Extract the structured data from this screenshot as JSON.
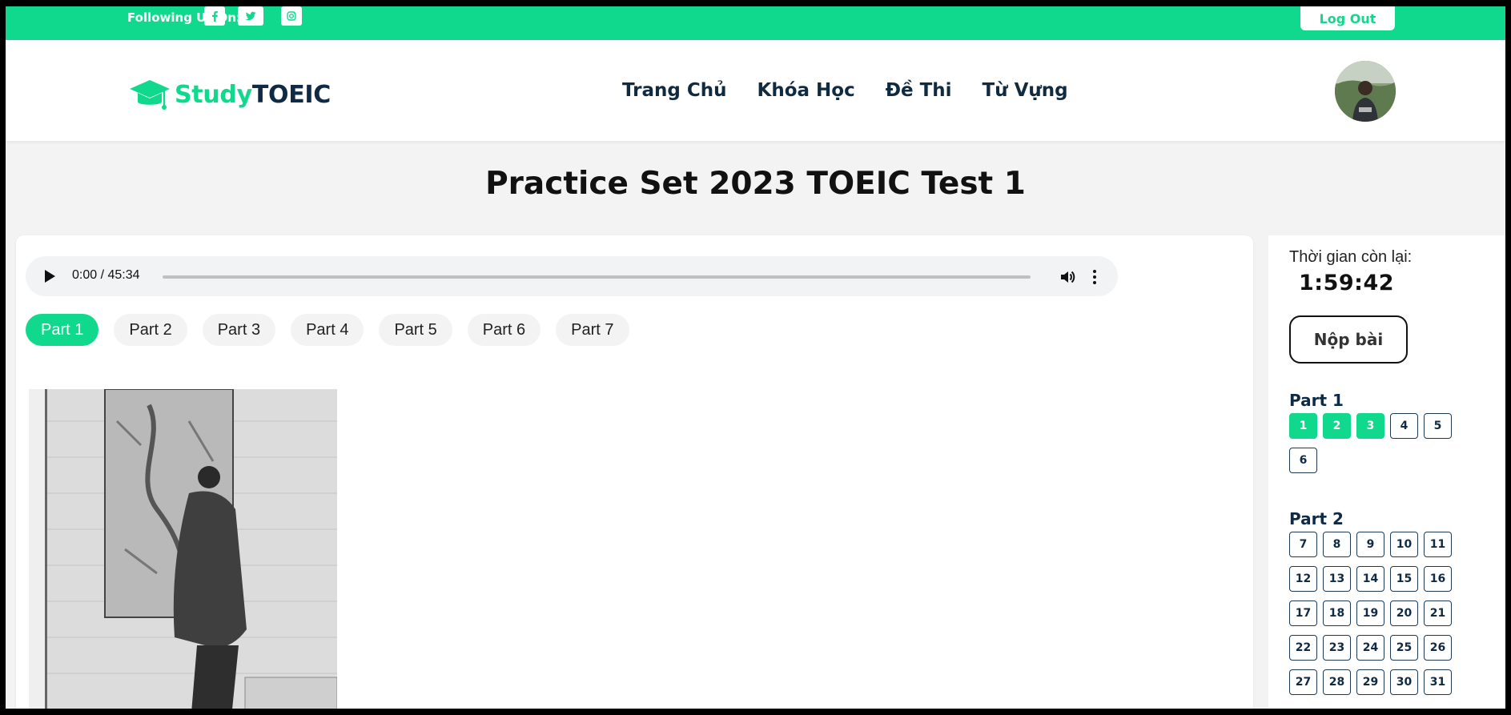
{
  "topbar": {
    "follow_label": "Following Us On:",
    "social": [
      "facebook-icon",
      "twitter-icon",
      "instagram-icon"
    ],
    "logout_label": "Log Out"
  },
  "header": {
    "logo_study": "Study",
    "logo_toeic": "TOEIC",
    "nav": [
      "Trang Chủ",
      "Khóa Học",
      "Đề Thi",
      "Từ Vựng"
    ]
  },
  "page": {
    "title": "Practice Set 2023 TOEIC Test 1"
  },
  "audio": {
    "time": "0:00 / 45:34"
  },
  "tabs": [
    "Part 1",
    "Part 2",
    "Part 3",
    "Part 4",
    "Part 5",
    "Part 6",
    "Part 7"
  ],
  "sidebar": {
    "timer_label": "Thời gian còn lại:",
    "timer": "1:59:42",
    "submit_label": "Nộp bài",
    "part1": {
      "title": "Part 1",
      "questions": [
        "1",
        "2",
        "3",
        "4",
        "5",
        "6"
      ],
      "answered": [
        "1",
        "2",
        "3"
      ]
    },
    "part2": {
      "title": "Part 2",
      "questions": [
        "7",
        "8",
        "9",
        "10",
        "11",
        "12",
        "13",
        "14",
        "15",
        "16",
        "17",
        "18",
        "19",
        "20",
        "21",
        "22",
        "23",
        "24",
        "25",
        "26",
        "27",
        "28",
        "29",
        "30",
        "31"
      ]
    }
  },
  "colors": {
    "accent": "#10d98d",
    "dark": "#0f2a44"
  }
}
